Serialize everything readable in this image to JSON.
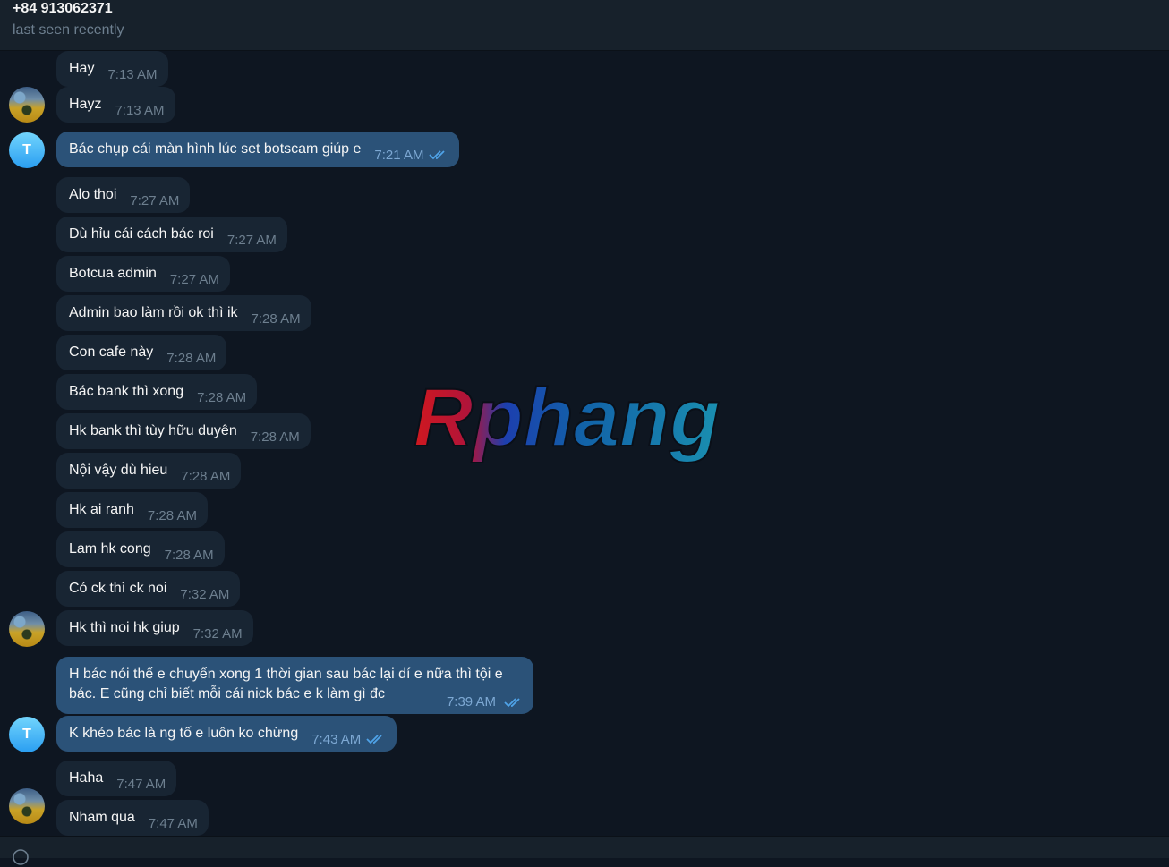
{
  "header": {
    "contact_name": "+84 913062371",
    "status": "last seen recently"
  },
  "avatars": {
    "incoming": "photo-avatar",
    "outgoing_letter": "T"
  },
  "messages": [
    {
      "text": "Hay",
      "time": "7:13 AM"
    },
    {
      "text": "Hayz",
      "time": "7:13 AM"
    },
    {
      "text": "Bác chụp cái màn hình lúc set botscam giúp e",
      "time": "7:21 AM"
    },
    {
      "text": "Alo thoi",
      "time": "7:27 AM"
    },
    {
      "text": "Dù hỉu cái cách bác roi",
      "time": "7:27 AM"
    },
    {
      "text": "Botcua admin",
      "time": "7:27 AM"
    },
    {
      "text": "Admin bao làm rồi ok thì ik",
      "time": "7:28 AM"
    },
    {
      "text": "Con cafe này",
      "time": "7:28 AM"
    },
    {
      "text": "Bác bank thì xong",
      "time": "7:28 AM"
    },
    {
      "text": "Hk bank thì tùy hữu duyên",
      "time": "7:28 AM"
    },
    {
      "text": "Nội vậy dù hieu",
      "time": "7:28 AM"
    },
    {
      "text": "Hk ai ranh",
      "time": "7:28 AM"
    },
    {
      "text": "Lam hk cong",
      "time": "7:28 AM"
    },
    {
      "text": "Có ck thì ck noi",
      "time": "7:32 AM"
    },
    {
      "text": "Hk thì noi hk giup",
      "time": "7:32 AM"
    },
    {
      "text": "H bác nói thế e chuyển xong 1 thời gian sau bác lại dí e nữa thì tội e bác. E cũng chỉ biết mỗi cái nick bác e k làm gì đc",
      "time": "7:39 AM"
    },
    {
      "text": "K khéo bác là ng tố e luôn ko chừng",
      "time": "7:43 AM"
    },
    {
      "text": "Haha",
      "time": "7:47 AM"
    },
    {
      "text": "Nham qua",
      "time": "7:47 AM"
    }
  ],
  "watermark": {
    "text": "Rphang"
  },
  "colors": {
    "background": "#0e1621",
    "header_bg": "#17212b",
    "incoming_bubble": "#182533",
    "outgoing_bubble": "#2b5278",
    "read_ticks": "#4fa3e8",
    "avatar_letter_bg": "#2a9ef1"
  },
  "icons": {
    "read_receipt": "double-check-icon",
    "attach": "paperclip-icon"
  }
}
